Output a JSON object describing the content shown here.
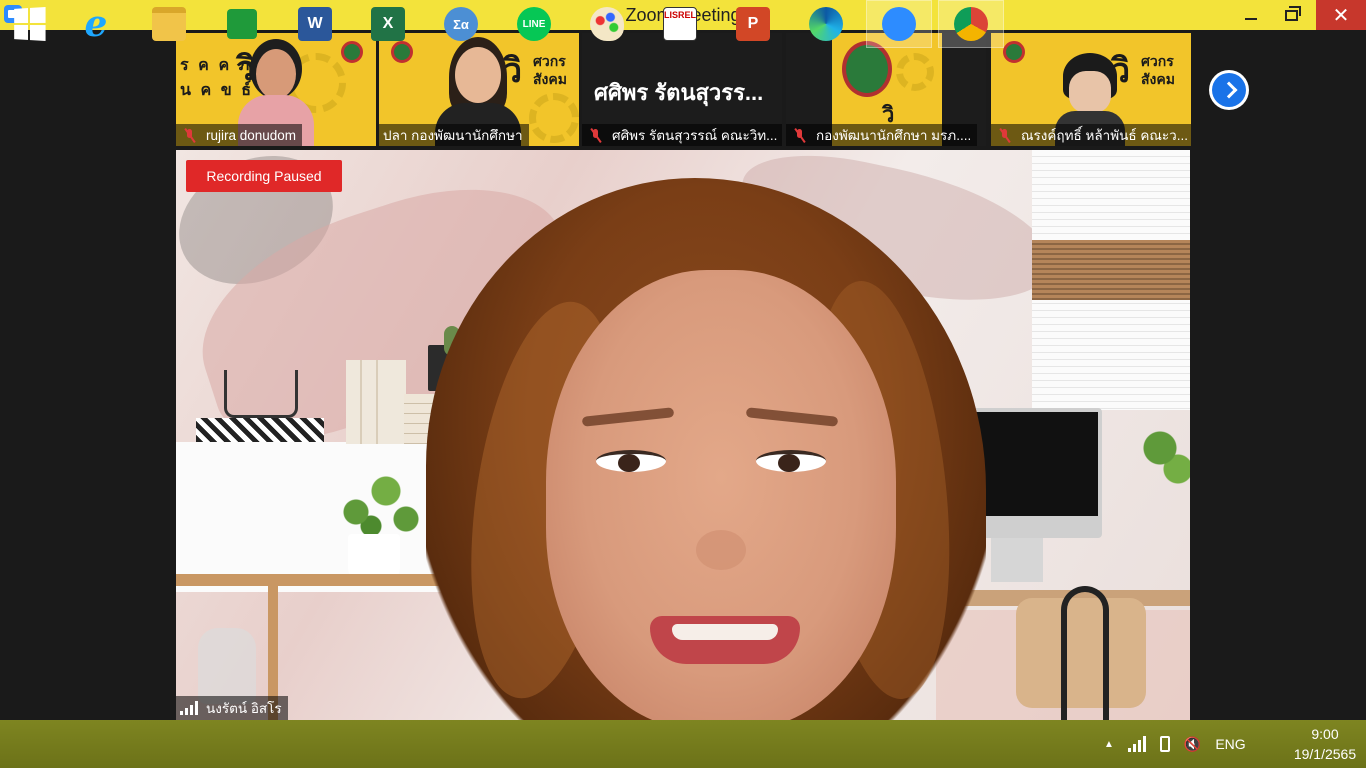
{
  "window": {
    "title": "Zoom Meeting"
  },
  "thumbnails": [
    {
      "name": "rujira donudom",
      "muted": true,
      "kind": "video"
    },
    {
      "name": "ปลา กองพัฒนานักศึกษา",
      "muted": false,
      "kind": "video"
    },
    {
      "name": "ศศิพร รัตนสุวรรณ์ คณะวิท...",
      "muted": true,
      "kind": "name-only",
      "display_name": "ศศิพร รัตนสุวรร..."
    },
    {
      "name": "กองพัฒนานักศึกษา มรภ....",
      "muted": true,
      "kind": "logo"
    },
    {
      "name": "ณรงค์ฤทธิ์ หล้าพันธ์ คณะว...",
      "muted": true,
      "kind": "video"
    }
  ],
  "thumbnail_next_icon": "chevron-right-icon",
  "poster_text": {
    "vi": "วิ",
    "sakon_a": "ศวกร",
    "sakon_b": "สังคม"
  },
  "main_video": {
    "recording_badge": "Recording Paused",
    "speaker_name": "นงรัตน์ อิสโร"
  },
  "taskbar": {
    "items": [
      {
        "icon": "windows-start-icon",
        "label": ""
      },
      {
        "icon": "internet-explorer-icon",
        "label": "e"
      },
      {
        "icon": "file-explorer-icon",
        "label": ""
      },
      {
        "icon": "store-icon",
        "label": ""
      },
      {
        "icon": "word-icon",
        "label": "W"
      },
      {
        "icon": "excel-icon",
        "label": "X"
      },
      {
        "icon": "math-input-icon",
        "label": "Σα"
      },
      {
        "icon": "line-icon",
        "label": "LINE"
      },
      {
        "icon": "paint-icon",
        "label": ""
      },
      {
        "icon": "lisrel-icon",
        "label": "LISREL"
      },
      {
        "icon": "powerpoint-icon",
        "label": "P"
      },
      {
        "icon": "edge-icon",
        "label": ""
      },
      {
        "icon": "zoom-icon",
        "label": ""
      },
      {
        "icon": "chrome-icon",
        "label": ""
      }
    ],
    "tray": {
      "language": "ENG",
      "time": "9:00",
      "date": "19/1/2565"
    }
  },
  "colors": {
    "titlebar": "#f3e33b",
    "close_button": "#c7372c",
    "recording_badge": "#e02828",
    "taskbar": "#767c1e",
    "zoom_blue": "#2d8cff",
    "poster_yellow": "#f2c52a"
  }
}
